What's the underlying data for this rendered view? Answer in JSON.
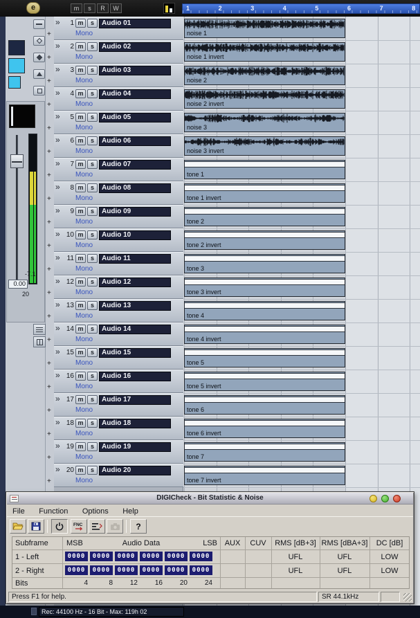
{
  "toolbar": {
    "edit_label": "e",
    "master_buttons": [
      "m",
      "s",
      "R",
      "W"
    ]
  },
  "ruler": {
    "bars": [
      "1",
      "2",
      "3",
      "4",
      "5",
      "6",
      "7",
      "8"
    ]
  },
  "inspector": {
    "peak": "-7.1",
    "fader_value": "0.00",
    "scale_label": "20"
  },
  "track_list": {
    "expand_glyph": "+",
    "type_glyph": "»"
  },
  "tracks": [
    {
      "num": "1",
      "name": "Audio 01",
      "channel": "Mono",
      "mute": "m",
      "solo": "s",
      "event": {
        "label": "noise 1",
        "kind": "noise"
      }
    },
    {
      "num": "2",
      "name": "Audio 02",
      "channel": "Mono",
      "mute": "m",
      "solo": "s",
      "event": {
        "label": "noise 1 invert",
        "kind": "noise"
      }
    },
    {
      "num": "3",
      "name": "Audio 03",
      "channel": "Mono",
      "mute": "m",
      "solo": "s",
      "event": {
        "label": "noise 2",
        "kind": "noise"
      }
    },
    {
      "num": "4",
      "name": "Audio 04",
      "channel": "Mono",
      "mute": "m",
      "solo": "s",
      "event": {
        "label": "noise 2 invert",
        "kind": "noise"
      }
    },
    {
      "num": "5",
      "name": "Audio 05",
      "channel": "Mono",
      "mute": "m",
      "solo": "s",
      "event": {
        "label": "noise 3",
        "kind": "noise"
      }
    },
    {
      "num": "6",
      "name": "Audio 06",
      "channel": "Mono",
      "mute": "m",
      "solo": "s",
      "event": {
        "label": "noise 3 invert",
        "kind": "noise"
      }
    },
    {
      "num": "7",
      "name": "Audio 07",
      "channel": "Mono",
      "mute": "m",
      "solo": "s",
      "event": {
        "label": "tone 1",
        "kind": "tone"
      }
    },
    {
      "num": "8",
      "name": "Audio 08",
      "channel": "Mono",
      "mute": "m",
      "solo": "s",
      "event": {
        "label": "tone 1 invert",
        "kind": "tone"
      }
    },
    {
      "num": "9",
      "name": "Audio 09",
      "channel": "Mono",
      "mute": "m",
      "solo": "s",
      "event": {
        "label": "tone 2",
        "kind": "tone"
      }
    },
    {
      "num": "10",
      "name": "Audio 10",
      "channel": "Mono",
      "mute": "m",
      "solo": "s",
      "event": {
        "label": "tone 2 invert",
        "kind": "tone"
      }
    },
    {
      "num": "11",
      "name": "Audio 11",
      "channel": "Mono",
      "mute": "m",
      "solo": "s",
      "event": {
        "label": "tone 3",
        "kind": "tone"
      }
    },
    {
      "num": "12",
      "name": "Audio 12",
      "channel": "Mono",
      "mute": "m",
      "solo": "s",
      "event": {
        "label": "tone 3 invert",
        "kind": "tone"
      }
    },
    {
      "num": "13",
      "name": "Audio 13",
      "channel": "Mono",
      "mute": "m",
      "solo": "s",
      "event": {
        "label": "tone 4",
        "kind": "tone"
      }
    },
    {
      "num": "14",
      "name": "Audio 14",
      "channel": "Mono",
      "mute": "m",
      "solo": "s",
      "event": {
        "label": "tone 4 invert",
        "kind": "tone"
      }
    },
    {
      "num": "15",
      "name": "Audio 15",
      "channel": "Mono",
      "mute": "m",
      "solo": "s",
      "event": {
        "label": "tone 5",
        "kind": "tone"
      }
    },
    {
      "num": "16",
      "name": "Audio 16",
      "channel": "Mono",
      "mute": "m",
      "solo": "s",
      "event": {
        "label": "tone 5 invert",
        "kind": "tone"
      }
    },
    {
      "num": "17",
      "name": "Audio 17",
      "channel": "Mono",
      "mute": "m",
      "solo": "s",
      "event": {
        "label": "tone 6",
        "kind": "tone"
      }
    },
    {
      "num": "18",
      "name": "Audio 18",
      "channel": "Mono",
      "mute": "m",
      "solo": "s",
      "event": {
        "label": "tone 6 invert",
        "kind": "tone"
      }
    },
    {
      "num": "19",
      "name": "Audio 19",
      "channel": "Mono",
      "mute": "m",
      "solo": "s",
      "event": {
        "label": "tone 7",
        "kind": "tone"
      }
    },
    {
      "num": "20",
      "name": "Audio 20",
      "channel": "Mono",
      "mute": "m",
      "solo": "s",
      "event": {
        "label": "tone 7 invert",
        "kind": "tone"
      }
    }
  ],
  "digicheck": {
    "title": "DIGICheck - Bit Statistic & Noise",
    "menu": [
      "File",
      "Function",
      "Options",
      "Help"
    ],
    "toolbar": {
      "fnc_label": "FNC",
      "help_label": "?"
    },
    "table": {
      "headers": {
        "subframe": "Subframe",
        "msb": "MSB",
        "audio_data": "Audio Data",
        "lsb": "LSB",
        "aux": "AUX",
        "cuv": "CUV",
        "rms_db": "RMS [dB+3]",
        "rms_dba": "RMS [dBA+3]",
        "dc": "DC [dB]"
      },
      "rows": [
        {
          "label": "1 - Left",
          "bit_groups": [
            "0000",
            "0000",
            "0000",
            "0000",
            "0000",
            "0000"
          ],
          "aux": "",
          "cuv": "",
          "rms_db": "UFL",
          "rms_dba": "UFL",
          "dc": "LOW"
        },
        {
          "label": "2 - Right",
          "bit_groups": [
            "0000",
            "0000",
            "0000",
            "0000",
            "0000",
            "0000"
          ],
          "aux": "",
          "cuv": "",
          "rms_db": "UFL",
          "rms_dba": "UFL",
          "dc": "LOW"
        }
      ],
      "bits_row": {
        "label": "Bits",
        "values": [
          "4",
          "8",
          "12",
          "16",
          "20",
          "24"
        ]
      }
    },
    "status": {
      "left": "Press F1 for help.",
      "right": "SR 44.1kHz"
    }
  },
  "taskbar": {
    "record_status": "Rec: 44100 Hz - 16 Bit - Max: 119h 02"
  },
  "colors": {
    "ruler_blue": "#3a6cd8",
    "event_fill": "#93a7bd",
    "bit_block": "#1c1c70",
    "meter_green": "#32c53a",
    "meter_yellow": "#dcd63a",
    "track_name_bg": "#1d2138"
  }
}
